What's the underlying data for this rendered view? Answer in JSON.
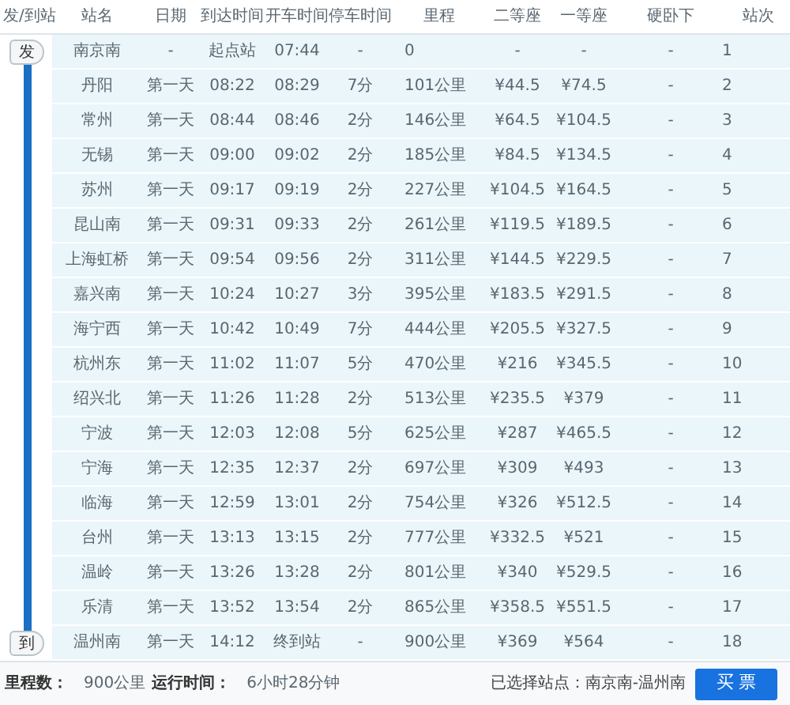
{
  "columns": [
    "发/到站",
    "站名",
    "日期",
    "到达时间",
    "开车时间",
    "停车时间",
    "里程",
    "二等座",
    "一等座",
    "硬卧下",
    "站次"
  ],
  "route": {
    "start": "发",
    "end": "到"
  },
  "rows": [
    {
      "station": "南京南",
      "date": "-",
      "arrive": "起点站",
      "depart": "07:44",
      "stop": "-",
      "distance": "0",
      "second": "-",
      "first": "-",
      "sleeper": "-",
      "no": "1"
    },
    {
      "station": "丹阳",
      "date": "第一天",
      "arrive": "08:22",
      "depart": "08:29",
      "stop": "7分",
      "distance": "101公里",
      "second": "¥44.5",
      "first": "¥74.5",
      "sleeper": "-",
      "no": "2"
    },
    {
      "station": "常州",
      "date": "第一天",
      "arrive": "08:44",
      "depart": "08:46",
      "stop": "2分",
      "distance": "146公里",
      "second": "¥64.5",
      "first": "¥104.5",
      "sleeper": "-",
      "no": "3"
    },
    {
      "station": "无锡",
      "date": "第一天",
      "arrive": "09:00",
      "depart": "09:02",
      "stop": "2分",
      "distance": "185公里",
      "second": "¥84.5",
      "first": "¥134.5",
      "sleeper": "-",
      "no": "4"
    },
    {
      "station": "苏州",
      "date": "第一天",
      "arrive": "09:17",
      "depart": "09:19",
      "stop": "2分",
      "distance": "227公里",
      "second": "¥104.5",
      "first": "¥164.5",
      "sleeper": "-",
      "no": "5"
    },
    {
      "station": "昆山南",
      "date": "第一天",
      "arrive": "09:31",
      "depart": "09:33",
      "stop": "2分",
      "distance": "261公里",
      "second": "¥119.5",
      "first": "¥189.5",
      "sleeper": "-",
      "no": "6"
    },
    {
      "station": "上海虹桥",
      "date": "第一天",
      "arrive": "09:54",
      "depart": "09:56",
      "stop": "2分",
      "distance": "311公里",
      "second": "¥144.5",
      "first": "¥229.5",
      "sleeper": "-",
      "no": "7"
    },
    {
      "station": "嘉兴南",
      "date": "第一天",
      "arrive": "10:24",
      "depart": "10:27",
      "stop": "3分",
      "distance": "395公里",
      "second": "¥183.5",
      "first": "¥291.5",
      "sleeper": "-",
      "no": "8"
    },
    {
      "station": "海宁西",
      "date": "第一天",
      "arrive": "10:42",
      "depart": "10:49",
      "stop": "7分",
      "distance": "444公里",
      "second": "¥205.5",
      "first": "¥327.5",
      "sleeper": "-",
      "no": "9"
    },
    {
      "station": "杭州东",
      "date": "第一天",
      "arrive": "11:02",
      "depart": "11:07",
      "stop": "5分",
      "distance": "470公里",
      "second": "¥216",
      "first": "¥345.5",
      "sleeper": "-",
      "no": "10"
    },
    {
      "station": "绍兴北",
      "date": "第一天",
      "arrive": "11:26",
      "depart": "11:28",
      "stop": "2分",
      "distance": "513公里",
      "second": "¥235.5",
      "first": "¥379",
      "sleeper": "-",
      "no": "11"
    },
    {
      "station": "宁波",
      "date": "第一天",
      "arrive": "12:03",
      "depart": "12:08",
      "stop": "5分",
      "distance": "625公里",
      "second": "¥287",
      "first": "¥465.5",
      "sleeper": "-",
      "no": "12"
    },
    {
      "station": "宁海",
      "date": "第一天",
      "arrive": "12:35",
      "depart": "12:37",
      "stop": "2分",
      "distance": "697公里",
      "second": "¥309",
      "first": "¥493",
      "sleeper": "-",
      "no": "13"
    },
    {
      "station": "临海",
      "date": "第一天",
      "arrive": "12:59",
      "depart": "13:01",
      "stop": "2分",
      "distance": "754公里",
      "second": "¥326",
      "first": "¥512.5",
      "sleeper": "-",
      "no": "14"
    },
    {
      "station": "台州",
      "date": "第一天",
      "arrive": "13:13",
      "depart": "13:15",
      "stop": "2分",
      "distance": "777公里",
      "second": "¥332.5",
      "first": "¥521",
      "sleeper": "-",
      "no": "15"
    },
    {
      "station": "温岭",
      "date": "第一天",
      "arrive": "13:26",
      "depart": "13:28",
      "stop": "2分",
      "distance": "801公里",
      "second": "¥340",
      "first": "¥529.5",
      "sleeper": "-",
      "no": "16"
    },
    {
      "station": "乐清",
      "date": "第一天",
      "arrive": "13:52",
      "depart": "13:54",
      "stop": "2分",
      "distance": "865公里",
      "second": "¥358.5",
      "first": "¥551.5",
      "sleeper": "-",
      "no": "17"
    },
    {
      "station": "温州南",
      "date": "第一天",
      "arrive": "14:12",
      "depart": "终到站",
      "stop": "-",
      "distance": "900公里",
      "second": "¥369",
      "first": "¥564",
      "sleeper": "-",
      "no": "18"
    }
  ],
  "footer": {
    "distance_label": "里程数：",
    "distance": "900公里",
    "time_label": "运行时间：",
    "time": "6小时28分钟",
    "selected": "已选择站点：南京南-温州南",
    "buy_button": "买 票"
  }
}
